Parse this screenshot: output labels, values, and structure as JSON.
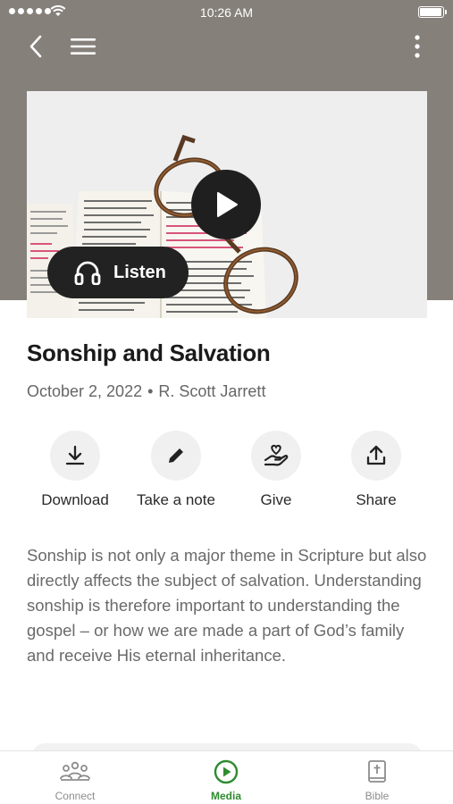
{
  "status_bar": {
    "time": "10:26 AM",
    "battery_level": 0.9
  },
  "nav": {
    "back_icon": "chevron-left-icon",
    "menu_icon": "hamburger-menu-icon",
    "more_icon": "more-vertical-icon"
  },
  "hero": {
    "listen_label": "Listen",
    "play_icon": "play-icon",
    "listen_icon": "headphones-icon"
  },
  "sermon": {
    "title": "Sonship and Salvation",
    "date": "October 2, 2022",
    "separator": "•",
    "speaker": "R. Scott Jarrett",
    "description": "Sonship is not only a major theme in Scripture but also directly affects the subject of salvation. Understanding sonship is therefore important to understanding the gospel – or how we are made a part of God’s family and receive His eternal inheritance."
  },
  "actions": [
    {
      "label": "Download",
      "icon": "download-icon"
    },
    {
      "label": "Take a note",
      "icon": "pencil-icon"
    },
    {
      "label": "Give",
      "icon": "give-heart-hand-icon"
    },
    {
      "label": "Share",
      "icon": "share-icon"
    }
  ],
  "tabs": [
    {
      "label": "Connect",
      "icon": "people-icon",
      "active": false
    },
    {
      "label": "Media",
      "icon": "play-circle-icon",
      "active": true
    },
    {
      "label": "Bible",
      "icon": "bible-icon",
      "active": false
    }
  ],
  "colors": {
    "header": "#86807b",
    "accent": "#2e8b2e",
    "dark_button": "#222222"
  }
}
